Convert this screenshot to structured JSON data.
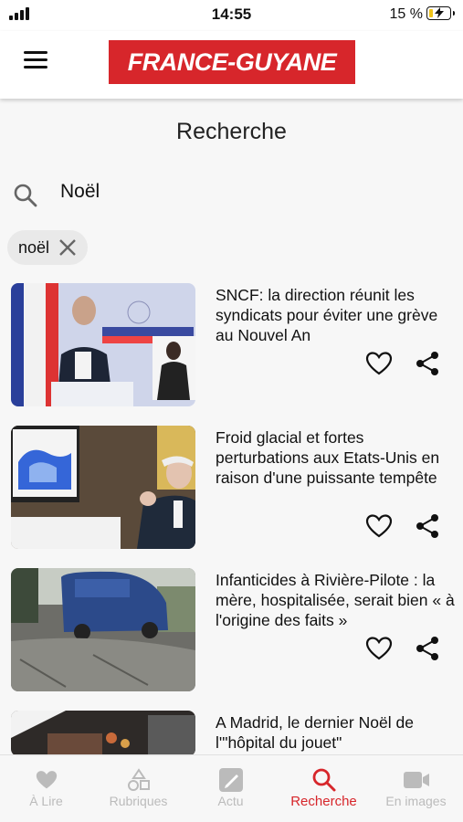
{
  "status_bar": {
    "time": "14:55",
    "battery_percent": "15 %",
    "battery_level": 0.15
  },
  "header": {
    "logo_text": "FRANCE-GUYANE",
    "brand_color": "#d7262b",
    "menu_icon": "hamburger-icon"
  },
  "page": {
    "title": "Recherche"
  },
  "search": {
    "value": "Noël",
    "icon": "search-icon"
  },
  "filter_chip": {
    "label": "noël"
  },
  "articles": [
    {
      "title": "SNCF: la direction réunit les syndicats pour éviter une grève au Nouvel An"
    },
    {
      "title": "Froid glacial et fortes perturbations aux Etats-Unis en raison d'une puissante tempête"
    },
    {
      "title": "Infanticides à Rivière-Pilote : la mère, hospitalisée, serait bien « à l'origine des faits »"
    },
    {
      "title": "A Madrid, le dernier Noël de l'\"hôpital du jouet\""
    }
  ],
  "nav": {
    "items": [
      {
        "label": "À Lire",
        "icon": "heart-icon"
      },
      {
        "label": "Rubriques",
        "icon": "shapes-icon"
      },
      {
        "label": "Actu",
        "icon": "news-icon"
      },
      {
        "label": "Recherche",
        "icon": "search-icon"
      },
      {
        "label": "En images",
        "icon": "video-camera-icon"
      }
    ],
    "active_index": 3,
    "active_color": "#d7262b"
  }
}
